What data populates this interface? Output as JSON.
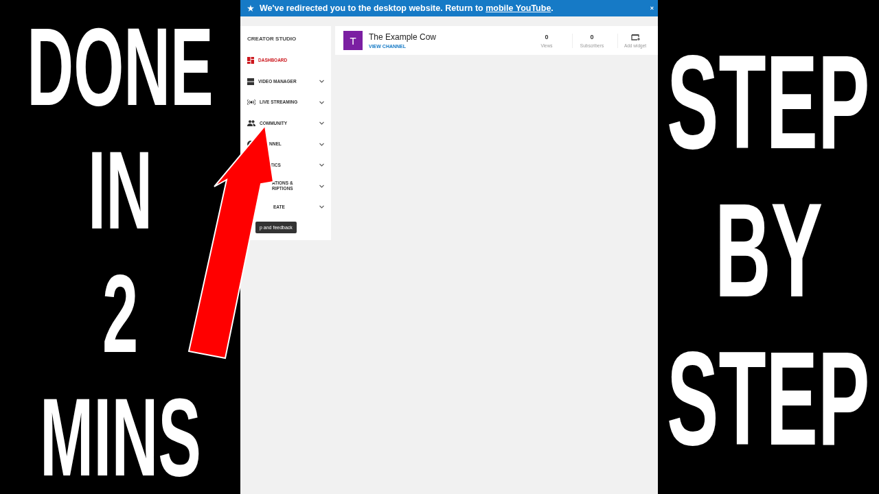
{
  "left_caption": [
    "DONE",
    "IN",
    "2",
    "MINS"
  ],
  "right_caption": [
    "STEP",
    "BY",
    "STEP"
  ],
  "banner": {
    "icon": "★",
    "text": "We've redirected you to the desktop website. Return to ",
    "link": "mobile YouTube",
    "after": ".",
    "close": "×"
  },
  "sidebar": {
    "title": "CREATOR STUDIO",
    "items": [
      {
        "kind": "dashboard",
        "lines": [
          "DASHBOARD"
        ],
        "selected": true,
        "expandable": false
      },
      {
        "kind": "video",
        "lines": [
          "VIDEO MANAGER"
        ],
        "selected": false,
        "expandable": true
      },
      {
        "kind": "live",
        "lines": [
          "LIVE STREAMING"
        ],
        "selected": false,
        "expandable": true
      },
      {
        "kind": "people",
        "lines": [
          "COMMUNITY"
        ],
        "selected": false,
        "expandable": true
      },
      {
        "kind": "account",
        "lines": [
          "NNEL"
        ],
        "selected": false,
        "expandable": true
      },
      {
        "kind": "plain",
        "lines": [
          "TICS"
        ],
        "selected": false,
        "expandable": true
      },
      {
        "kind": "plain",
        "lines": [
          "ATIONS &",
          "RIPTIONS"
        ],
        "selected": false,
        "expandable": true
      },
      {
        "kind": "plain",
        "lines": [
          "EATE"
        ],
        "selected": false,
        "expandable": true
      }
    ],
    "help_button": "p and feedback"
  },
  "channel": {
    "avatar": "T",
    "name": "The Example Cow",
    "link": "VIEW CHANNEL",
    "stats": [
      {
        "value": "0",
        "label": "Views"
      },
      {
        "value": "0",
        "label": "Subscribers"
      }
    ],
    "add_widget": "Add widget"
  }
}
